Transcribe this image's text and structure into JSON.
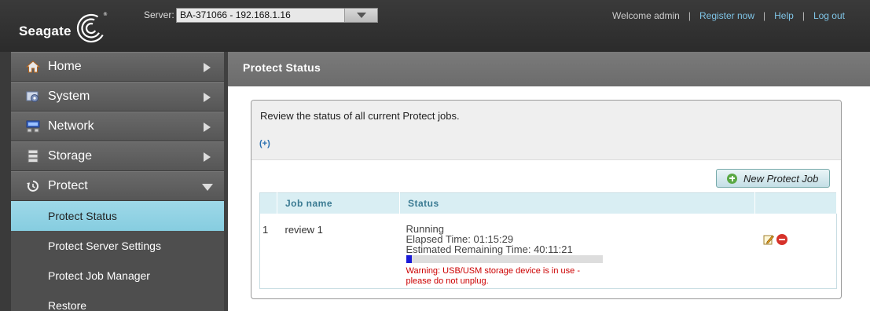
{
  "header": {
    "brand": "Seagate",
    "server_label": "Server:",
    "server_value": "BA-371066 - 192.168.1.16",
    "welcome": "Welcome admin",
    "register": "Register now",
    "help": "Help",
    "logout": "Log out"
  },
  "sidebar": {
    "items": [
      {
        "label": "Home",
        "icon": "home-icon"
      },
      {
        "label": "System",
        "icon": "system-icon"
      },
      {
        "label": "Network",
        "icon": "network-icon"
      },
      {
        "label": "Storage",
        "icon": "storage-icon"
      },
      {
        "label": "Protect",
        "icon": "protect-icon"
      }
    ],
    "sub_items": [
      {
        "label": "Protect Status",
        "active": true
      },
      {
        "label": "Protect Server Settings"
      },
      {
        "label": "Protect Job Manager"
      },
      {
        "label": "Restore"
      }
    ]
  },
  "main": {
    "title": "Protect Status",
    "description": "Review the status of all current Protect jobs.",
    "expand_link": "(+)",
    "new_job_button": "New Protect Job",
    "table": {
      "headers": [
        "",
        "Job name",
        "Status",
        ""
      ],
      "rows": [
        {
          "index": "1",
          "name": "review 1",
          "status": "Running",
          "elapsed": "Elapsed Time: 01:15:29",
          "remaining": "Estimated Remaining Time: 40:11:21",
          "progress_fraction": 0.03,
          "warning": "Warning: USB/USM storage device is in use - please do not unplug."
        }
      ]
    }
  },
  "colors": {
    "accent": "#86cde0",
    "link": "#7fc4e6",
    "warning": "#cc0000",
    "progress": "#1a1ad8"
  }
}
